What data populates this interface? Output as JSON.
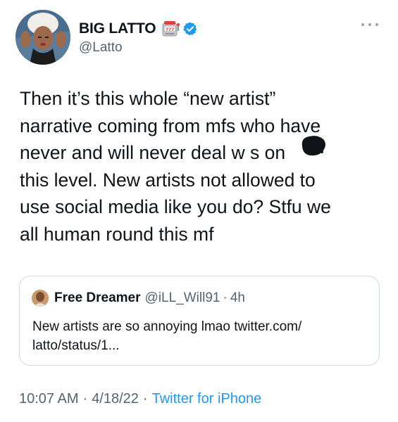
{
  "author": {
    "display_name": "BIG LATTO",
    "handle": "@Latto",
    "emoji_icon": "slot-machine-icon",
    "verified_icon": "verified-badge-icon"
  },
  "tweet": {
    "text": "Then it’s this whole “new artist”\nnarrative coming from mfs who have\nnever and will never deal w s     on\nthis level. New artists not allowed to\nuse social media like you do? Stfu we\nall human round this mf"
  },
  "quoted_tweet": {
    "display_name": "Free Dreamer",
    "handle": "@iLL_Will91",
    "separator": "·",
    "time": "4h",
    "text": "New artists are so annoying lmao twitter.com/\nlatto/status/1..."
  },
  "meta": {
    "time": "10:07 AM",
    "separator": "·",
    "date": "4/18/22",
    "source": "Twitter for iPhone"
  },
  "colors": {
    "text": "#0f1419",
    "secondary": "#536471",
    "link": "#1d9bf0",
    "border": "#cfd9de",
    "verified": "#1d9bf0"
  }
}
